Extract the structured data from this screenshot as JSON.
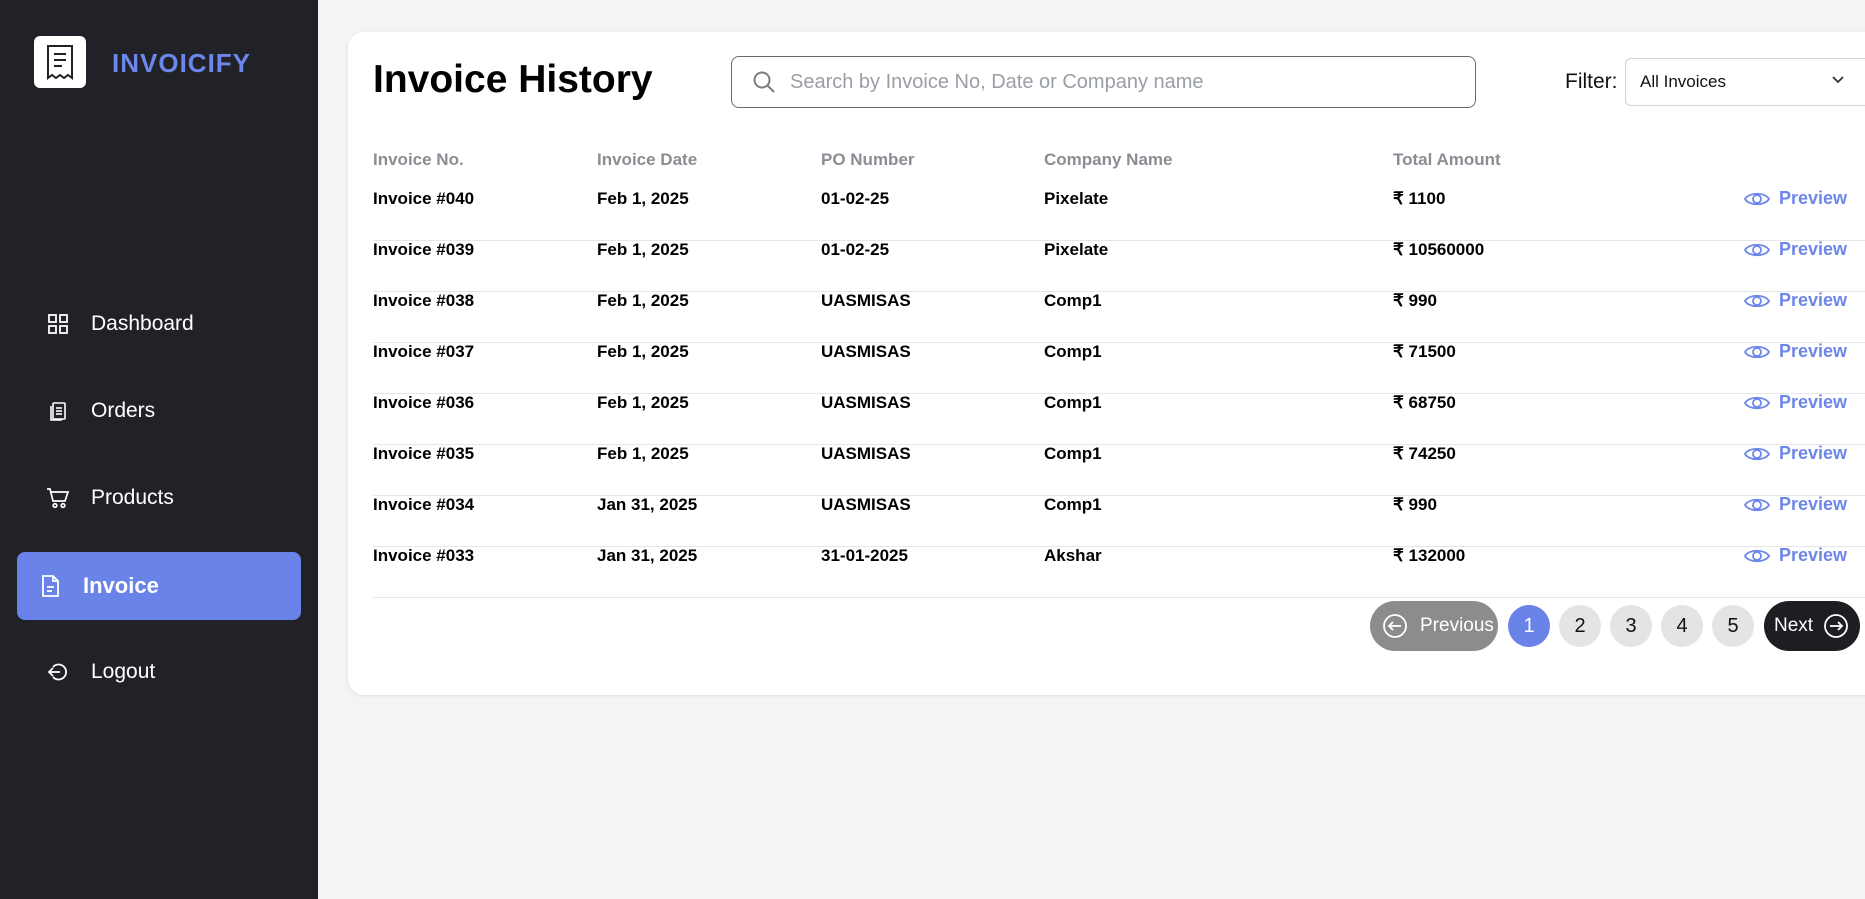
{
  "brand": {
    "name": "INVOICIFY",
    "icon": "receipt-icon"
  },
  "nav": [
    {
      "label": "Dashboard",
      "icon": "grid-icon",
      "active": false
    },
    {
      "label": "Orders",
      "icon": "clipboard-icon",
      "active": false
    },
    {
      "label": "Products",
      "icon": "cart-icon",
      "active": false
    },
    {
      "label": "Invoice",
      "icon": "document-icon",
      "active": true
    },
    {
      "label": "Logout",
      "icon": "logout-icon",
      "active": false
    }
  ],
  "header": {
    "title": "Invoice History",
    "search_placeholder": "Search by Invoice No, Date or Company name",
    "filter_label": "Filter:",
    "filter_value": "All Invoices"
  },
  "table": {
    "columns": [
      "Invoice No.",
      "Invoice Date",
      "PO Number",
      "Company Name",
      "Total Amount"
    ],
    "action_label": "Preview",
    "rows": [
      {
        "invoice_no": "Invoice #040",
        "date": "Feb 1, 2025",
        "po": "01-02-25",
        "company": "Pixelate",
        "amount": "₹ 1100"
      },
      {
        "invoice_no": "Invoice #039",
        "date": "Feb 1, 2025",
        "po": "01-02-25",
        "company": "Pixelate",
        "amount": "₹ 10560000"
      },
      {
        "invoice_no": "Invoice #038",
        "date": "Feb 1, 2025",
        "po": "UASMISAS",
        "company": "Comp1",
        "amount": "₹ 990"
      },
      {
        "invoice_no": "Invoice #037",
        "date": "Feb 1, 2025",
        "po": "UASMISAS",
        "company": "Comp1",
        "amount": "₹ 71500"
      },
      {
        "invoice_no": "Invoice #036",
        "date": "Feb 1, 2025",
        "po": "UASMISAS",
        "company": "Comp1",
        "amount": "₹ 68750"
      },
      {
        "invoice_no": "Invoice #035",
        "date": "Feb 1, 2025",
        "po": "UASMISAS",
        "company": "Comp1",
        "amount": "₹ 74250"
      },
      {
        "invoice_no": "Invoice #034",
        "date": "Jan 31, 2025",
        "po": "UASMISAS",
        "company": "Comp1",
        "amount": "₹ 990"
      },
      {
        "invoice_no": "Invoice #033",
        "date": "Jan 31, 2025",
        "po": "31-01-2025",
        "company": "Akshar",
        "amount": "₹ 132000"
      }
    ]
  },
  "pagination": {
    "previous_label": "Previous",
    "next_label": "Next",
    "pages": [
      "1",
      "2",
      "3",
      "4",
      "5"
    ],
    "current": "1"
  },
  "colors": {
    "accent": "#6a83e8",
    "sidebar": "#212228",
    "background": "#f3f4f6"
  }
}
